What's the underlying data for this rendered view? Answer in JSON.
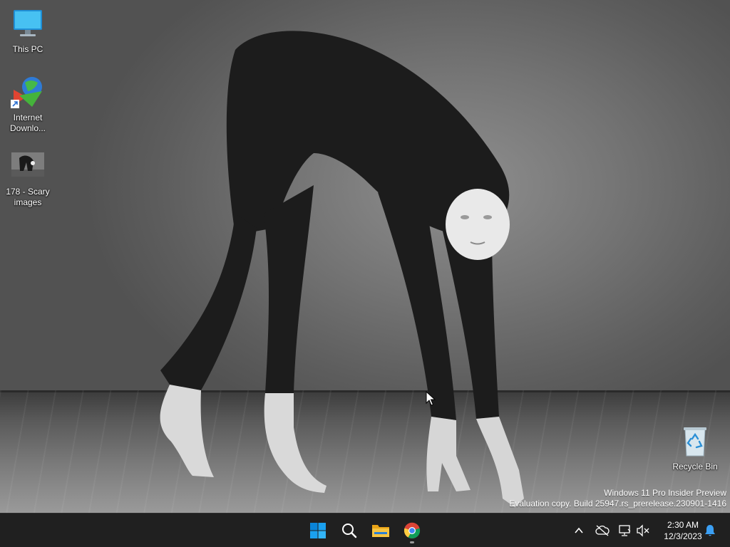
{
  "desktop": {
    "icons": [
      {
        "label": "This PC",
        "icon": "monitor-icon"
      },
      {
        "label": "Internet Downlo...",
        "icon": "internet-download-manager-icon"
      },
      {
        "label": "178 - Scary images",
        "icon": "image-thumbnail-icon"
      },
      {
        "label": "Recycle Bin",
        "icon": "recycle-bin-icon"
      }
    ]
  },
  "watermark": {
    "line1": "Windows 11 Pro Insider Preview",
    "line2": "Evaluation copy. Build 25947.rs_prerelease.230901-1416"
  },
  "taskbar": {
    "pinned": [
      {
        "name": "Start",
        "icon": "windows-start-icon"
      },
      {
        "name": "Search",
        "icon": "search-icon"
      },
      {
        "name": "File Explorer",
        "icon": "folder-icon"
      },
      {
        "name": "Google Chrome",
        "icon": "chrome-icon",
        "running": true
      }
    ],
    "tray": [
      {
        "icon": "chevron-up-icon"
      },
      {
        "icon": "cloud-offline-icon"
      },
      {
        "icon": "network-icon"
      },
      {
        "icon": "volume-muted-icon"
      },
      {
        "icon": "notification-bell-icon"
      }
    ],
    "clock": {
      "time": "2:30 AM",
      "date": "12/3/2023"
    }
  },
  "colors": {
    "taskbar": "#202020",
    "start_blue": "#0a84d8",
    "folder_yellow": "#f2b21c"
  }
}
